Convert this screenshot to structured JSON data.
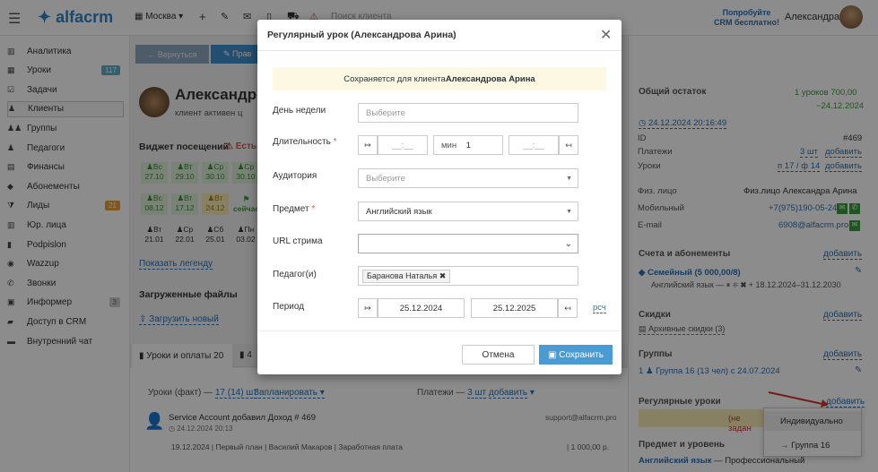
{
  "topbar": {
    "logo": "alfacrm",
    "city": "Москва",
    "search_placeholder": "Поиск клиента",
    "promo_line1": "Попробуйте",
    "promo_line2": "CRM бесплатно!",
    "user": "Александра"
  },
  "sidebar": {
    "items": [
      {
        "label": "Аналитика",
        "icon": "chart-icon"
      },
      {
        "label": "Уроки",
        "icon": "calendar-icon",
        "badge": "117"
      },
      {
        "label": "Задачи",
        "icon": "tasks-icon"
      },
      {
        "label": "Клиенты",
        "icon": "user-icon"
      },
      {
        "label": "Группы",
        "icon": "group-icon"
      },
      {
        "label": "Педагоги",
        "icon": "teacher-icon"
      },
      {
        "label": "Финансы",
        "icon": "money-icon"
      },
      {
        "label": "Абонементы",
        "icon": "tag-icon"
      },
      {
        "label": "Лиды",
        "icon": "funnel-icon",
        "badge": "21"
      },
      {
        "label": "Юр. лица",
        "icon": "building-icon"
      },
      {
        "label": "Podpislon",
        "icon": "doc-icon"
      },
      {
        "label": "Wazzup",
        "icon": "whatsapp-icon"
      },
      {
        "label": "Звонки",
        "icon": "phone-icon"
      },
      {
        "label": "Информер",
        "icon": "info-icon",
        "badge": "3"
      },
      {
        "label": "Доступ в CRM",
        "icon": "lock-icon"
      },
      {
        "label": "Внутренний чат",
        "icon": "chat-icon"
      }
    ]
  },
  "main": {
    "back": "← Вернуться",
    "edit": "✎ Прав",
    "client_name": "Александро",
    "client_status": "клиент активен ц",
    "widget_title": "Виджет посещений",
    "widget_warn": "⚠ Есть с",
    "cells_row1": [
      "♟Вс\n27.10",
      "♟Вт\n29.10",
      "♟Ср\n30.10",
      "♟Ср\n30.10"
    ],
    "cells_row2": [
      "♟Вс\n08.12",
      "♟Вт\n17.12",
      "♟Вт\n24.12"
    ],
    "now_label": "сейчас",
    "plan_row": [
      "♟Вт\n21.01",
      "♟Ср\n22.01",
      "♟Сб\n25.01",
      "♟Пн\n03.02"
    ],
    "legend_link": "Показать легенду",
    "files_title": "Загруженные файлы",
    "upload_link": "Загрузить новый",
    "tab_lessons": "Уроки и оплаты 20",
    "tab2": "4",
    "lessons_fact": "Уроки (факт) —",
    "lessons_fact_link": "17 (14) шт",
    "planned": "Запланировать",
    "payments": "Платежи —",
    "payments_link": "3 шт",
    "add": "добавить",
    "feed_text": "Service Account добавил Доход # 469",
    "feed_email": "support@alfacrm.pro",
    "feed_time": "24.12.2024   20:13",
    "feed_line2": "19.12.2024 | Первый план | Василий Макаров | Заработная плата",
    "feed_amount": "| 1 000,00 р."
  },
  "right": {
    "balance_title": "Общий остаток",
    "balance_val": "1 уроков  700,00",
    "balance_date": "~24.12.2024",
    "datetime": "24.12.2024 20:16:49",
    "rows": [
      {
        "k": "ID",
        "v": "#469"
      },
      {
        "k": "Платежи",
        "v": "3 шт",
        "a": "добавить"
      },
      {
        "k": "Уроки",
        "v": "п 17 / ф 14",
        "a": "добавить"
      },
      {
        "k": "Физ. лицо",
        "v": "Физ.лицо Александра Арина"
      },
      {
        "k": "Мобильный",
        "v": "+7(975)190-05-24"
      },
      {
        "k": "E-mail",
        "v": "6908@alfacrm.pro"
      }
    ],
    "accounts_title": "Счета и абонементы",
    "accounts_sub": "Семейный (5 000,00/8)",
    "accounts_line": "Английский язык — ⏸ ❄ ✖ + 18.12.2024–31.12.2030",
    "discounts_title": "Скидки",
    "discounts_sub": "Архивные скидки (3)",
    "groups_title": "Группы",
    "groups_line": "Группа 16 (13 чел) с 24.07.2024",
    "groups_count": "1",
    "regular_title": "Регулярные уроки",
    "regular_none": "(не задан",
    "subject_title": "Предмет и уровень",
    "subject_line": "Английский язык",
    "subject_level": "— Профессиональный",
    "dropdown": [
      "Индивидуально",
      "→ Группа 16"
    ]
  },
  "modal": {
    "title": "Регулярный урок (Александрова Арина)",
    "notice_prefix": "Сохраняется для клиента ",
    "notice_name": "Александрова Арина",
    "day_label": "День недели",
    "day_ph": "Выберите",
    "dur_label": "Длительность",
    "dur_time_ph": "__:__",
    "dur_min_label": "мин",
    "dur_min_val": "1",
    "dur_time2_ph": "__:__",
    "room_label": "Аудитория",
    "room_ph": "Выберите",
    "subject_label": "Предмет",
    "subject_val": "Английский язык",
    "url_label": "URL стрима",
    "teacher_label": "Педагог(и)",
    "teacher_tag": "Баранова Наталья",
    "period_label": "Период",
    "period_from": "25.12.2024",
    "period_to": "25.12.2025",
    "rsch": "рсч",
    "cancel": "Отмена",
    "save": "Сохранить"
  },
  "colors": {
    "accent": "#3e8ed0",
    "green": "#3a9b3a",
    "link": "#2a6fb4",
    "save_bg": "#4a9ad4"
  }
}
